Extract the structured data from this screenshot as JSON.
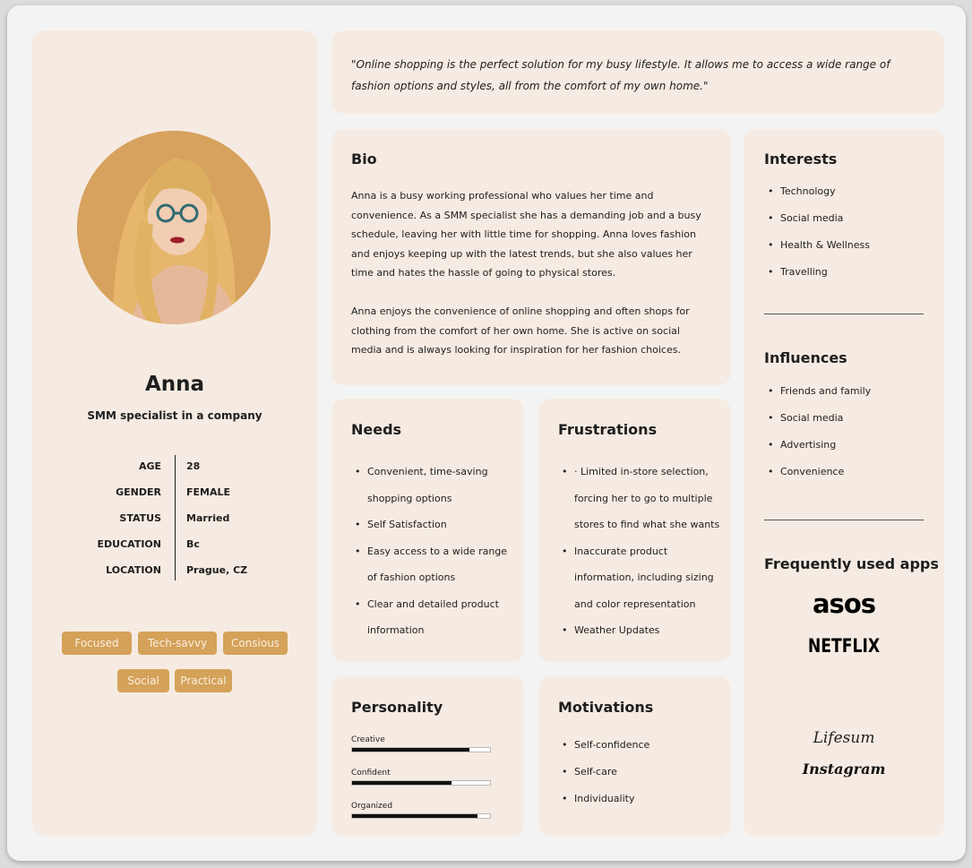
{
  "persona": {
    "name": "Anna",
    "role": "SMM specialist in a company",
    "attributes": [
      {
        "key": "AGE",
        "value": "28"
      },
      {
        "key": "GENDER",
        "value": "FEMALE"
      },
      {
        "key": "STATUS",
        "value": "Married"
      },
      {
        "key": "EDUCATION",
        "value": "Bc"
      },
      {
        "key": "LOCATION",
        "value": "Prague, CZ"
      }
    ],
    "tags": [
      "Focused",
      "Tech-savvy",
      "Consious",
      "Social",
      "Practical"
    ]
  },
  "quote": "\"Online shopping is the perfect solution for my busy lifestyle. It allows me to access a wide range of fashion options and styles, all from the comfort of my own home.\"",
  "bio": {
    "title": "Bio",
    "paragraph1": "Anna is a busy working professional who values her time and convenience. As a SMM specialist she has a demanding job and a busy schedule, leaving her with little time for shopping. Anna loves fashion and enjoys keeping up with the latest trends, but she also values her time and hates the hassle of going to physical stores.",
    "paragraph2": "Anna enjoys the convenience of online shopping and often shops for clothing from the comfort of her own home. She is active on social media and is always looking for inspiration for her fashion choices."
  },
  "interests": {
    "title": "Interests",
    "items": [
      "Technology",
      "Social media",
      "Health & Wellness",
      "Travelling"
    ]
  },
  "influences": {
    "title": "Influences",
    "items": [
      "Friends and family",
      "Social media",
      "Advertising",
      "Convenience"
    ]
  },
  "apps": {
    "title": "Frequently used apps",
    "items": [
      "asos",
      "NETFLIX",
      "Lifesum",
      "Instagram"
    ]
  },
  "needs": {
    "title": "Needs",
    "items": [
      "Convenient, time-saving shopping options",
      "Self Satisfaction",
      "Easy access to a wide range of fashion options",
      "Clear and detailed product information"
    ]
  },
  "frustrations": {
    "title": "Frustrations",
    "items": [
      "· Limited in-store selection, forcing her to go to multiple stores to find what she wants",
      "Inaccurate product information, including sizing and color representation",
      "Weather Updates"
    ]
  },
  "personality": {
    "title": "Personality",
    "traits": [
      {
        "label": "Creative",
        "level": 0.85
      },
      {
        "label": "Confident",
        "level": 0.72
      },
      {
        "label": "Organized",
        "level": 0.91
      }
    ]
  },
  "motivations": {
    "title": "Motivations",
    "items": [
      "Self-confidence",
      "Self-care",
      "Individuality"
    ]
  },
  "colors": {
    "card": "#f6ebe2",
    "tag": "#d4a259",
    "photo_bg": "#d6a25e",
    "bar": "#111111"
  }
}
